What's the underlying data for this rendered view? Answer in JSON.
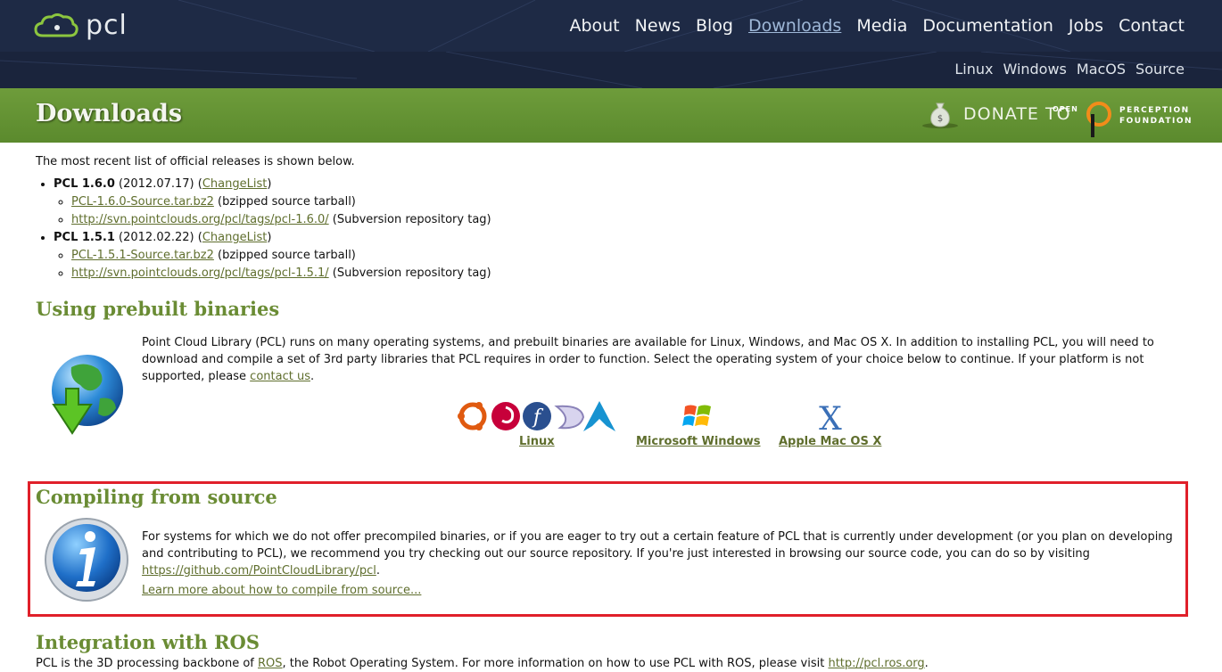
{
  "logo": {
    "text": "pcl"
  },
  "nav": {
    "main": [
      "About",
      "News",
      "Blog",
      "Downloads",
      "Media",
      "Documentation",
      "Jobs",
      "Contact"
    ],
    "sub": [
      "Linux",
      "Windows",
      "MacOS",
      "Source"
    ]
  },
  "banner": {
    "title": "Downloads",
    "donate": "DONATE TO",
    "open": "OPEN",
    "org_line1": "PERCEPTION",
    "org_line2": "FOUNDATION"
  },
  "intro": "The most recent list of official releases is shown below.",
  "releases": [
    {
      "name": "PCL 1.6.0",
      "date": "(2012.07.17) (",
      "changelist": "ChangeList",
      "close": ")",
      "tarball": "PCL-1.6.0-Source.tar.bz2",
      "tarball_desc": " (bzipped source tarball)",
      "svn": "http://svn.pointclouds.org/pcl/tags/pcl-1.6.0/",
      "svn_desc": " (Subversion repository tag)"
    },
    {
      "name": "PCL 1.5.1",
      "date": "(2012.02.22) (",
      "changelist": "ChangeList",
      "close": ")",
      "tarball": "PCL-1.5.1-Source.tar.bz2",
      "tarball_desc": " (bzipped source tarball)",
      "svn": "http://svn.pointclouds.org/pcl/tags/pcl-1.5.1/",
      "svn_desc": " (Subversion repository tag)"
    }
  ],
  "prebuilt": {
    "title": "Using prebuilt binaries",
    "body": "Point Cloud Library (PCL) runs on many operating systems, and prebuilt binaries are available for Linux, Windows, and Mac OS X. In addition to installing PCL, you will need to download and compile a set of 3rd party libraries that PCL requires in order to function. Select the operating system of your choice below to continue. If your platform is not supported, please ",
    "contact": "contact us",
    "end": ".",
    "os": [
      "Linux",
      "Microsoft Windows",
      "Apple Mac OS X"
    ]
  },
  "source": {
    "title": "Compiling from source",
    "body": "For systems for which we do not offer precompiled binaries, or if you are eager to try out a certain feature of PCL that is currently under development (or you plan on developing and contributing to PCL), we recommend you try checking out our source repository. If you're just interested in browsing our source code, you can do so by visiting ",
    "github": "https://github.com/PointCloudLibrary/pcl",
    "end": ".",
    "learn": "Learn more about how to compile from source..."
  },
  "ros": {
    "title": "Integration with ROS",
    "body1": "PCL is the 3D processing backbone of ",
    "ros_link": "ROS",
    "body2": ", the Robot Operating System. For more information on how to use PCL with ROS, please visit ",
    "ros_url": "http://pcl.ros.org",
    "end": "."
  },
  "colors": {
    "nav_bg": "#1e2a45",
    "banner": "#6e9c3b",
    "heading": "#6a8c34",
    "link": "#5f6e2d",
    "highlight": "#e0202a"
  },
  "icons": [
    "cloud-logo-icon",
    "money-bag-icon",
    "globe-download-icon",
    "ubuntu-icon",
    "debian-icon",
    "fedora-icon",
    "mandriva-icon",
    "arch-icon",
    "windows-icon",
    "mac-x-icon",
    "info-icon"
  ]
}
